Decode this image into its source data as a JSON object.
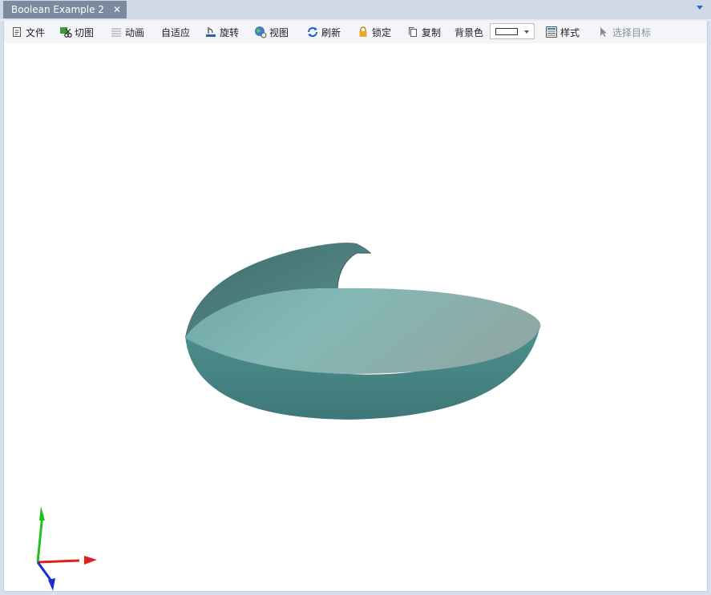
{
  "tab": {
    "title": "Boolean Example 2",
    "close_glyph": "✕"
  },
  "toolbar": {
    "file": "文件",
    "cut_view": "切图",
    "animation": "动画",
    "fit": "自适应",
    "rotate": "旋转",
    "view": "视图",
    "refresh": "刷新",
    "lock": "锁定",
    "copy": "复制",
    "background_color": "背景色",
    "style": "样式",
    "select_target": "选择目标"
  },
  "viewport": {
    "model": "bowl-surface",
    "axes_colors": {
      "x": "#e0201a",
      "y": "#1fc21f",
      "z": "#1a2fc8"
    },
    "surface_color": "#5f9c9c"
  }
}
